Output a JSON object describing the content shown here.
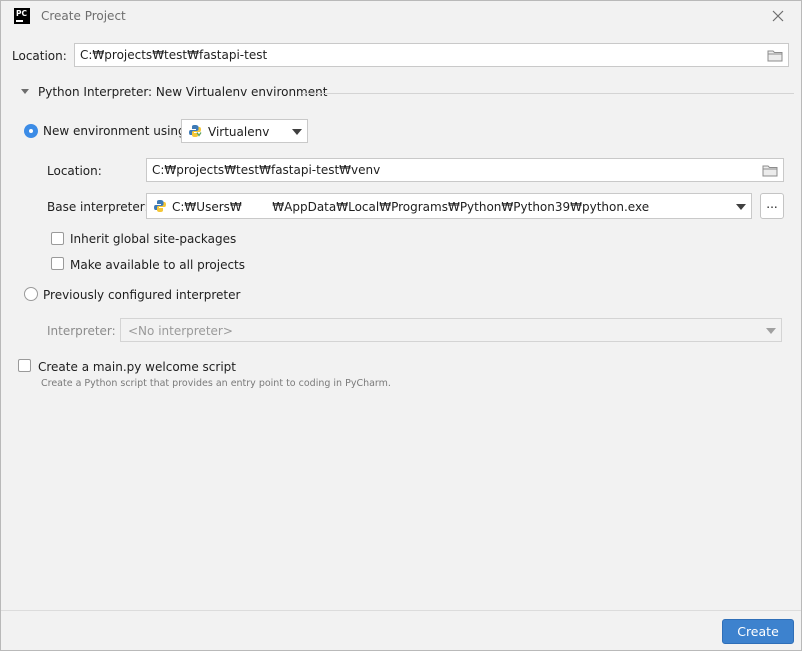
{
  "window": {
    "title": "Create Project",
    "logo_text": "PC"
  },
  "location": {
    "label": "Location:",
    "value": "C:₩projects₩test₩fastapi-test"
  },
  "interpreter_section": {
    "title": "Python Interpreter: New Virtualenv environment"
  },
  "new_env": {
    "label": "New environment using",
    "selected": true,
    "tool": "Virtualenv",
    "location_label": "Location:",
    "location_value": "C:₩projects₩test₩fastapi-test₩venv",
    "base_label": "Base interpreter:",
    "base_value": "C:₩Users₩        ₩AppData₩Local₩Programs₩Python₩Python39₩python.exe",
    "browse_label": "...",
    "inherit_label": "Inherit global site-packages",
    "inherit_checked": false,
    "available_label": "Make available to all projects",
    "available_checked": false
  },
  "previous": {
    "label": "Previously configured interpreter",
    "selected": false,
    "interpreter_label": "Interpreter:",
    "interpreter_value": "<No interpreter>"
  },
  "welcome": {
    "label": "Create a main.py welcome script",
    "checked": false,
    "hint": "Create a Python script that provides an entry point to coding in PyCharm."
  },
  "footer": {
    "create_label": "Create"
  },
  "colors": {
    "accent": "#3c8ce6",
    "create_button": "#3d82ce",
    "background": "#f2f2f2"
  }
}
